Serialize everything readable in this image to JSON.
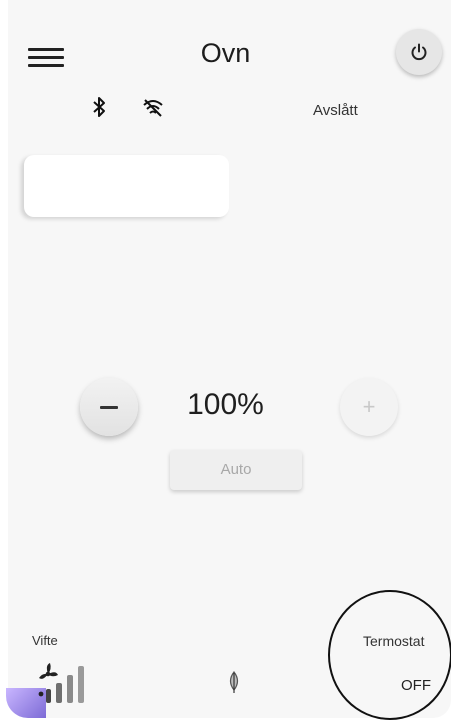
{
  "header": {
    "title": "Ovn",
    "menu_icon": "menu-icon",
    "power_icon": "power-icon"
  },
  "status": {
    "bluetooth_icon": "bluetooth-icon",
    "wifi_icon": "wifi-off-icon",
    "text": "Avslått"
  },
  "control": {
    "level": "100%",
    "minus_icon": "minus-icon",
    "plus_icon": "plus-icon",
    "auto_label": "Auto"
  },
  "bottom": {
    "fan_label": "Vifte",
    "fan_icon": "fan-speed-icon",
    "eco_icon": "leaf-icon",
    "thermostat_label": "Termostat",
    "thermostat_value": "OFF"
  },
  "colors": {
    "accent": "#7d6bd6",
    "button_bg": "#e6e6e6",
    "screen_bg": "#f7f7f7"
  }
}
